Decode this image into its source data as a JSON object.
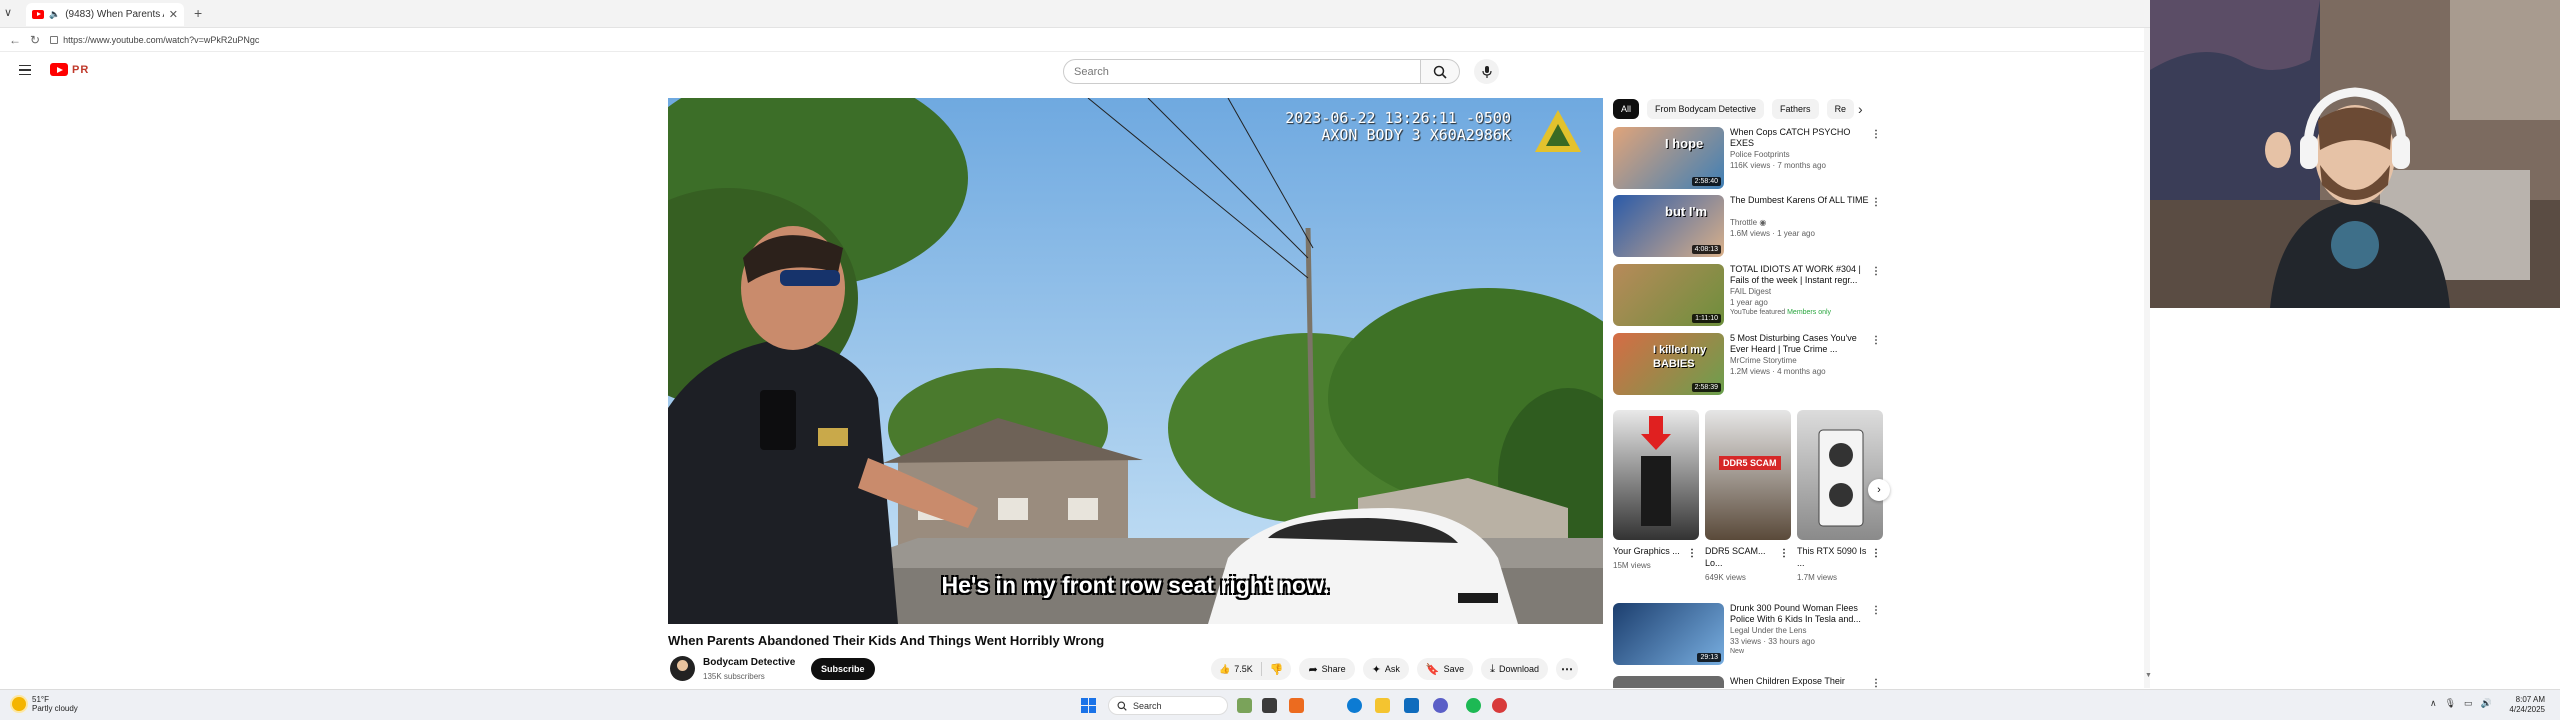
{
  "browser": {
    "tab_title": "(9483) When Parents Abando",
    "url": "https://www.youtube.com/watch?v=wPkR2uPNgc"
  },
  "youtube": {
    "logo_text": "PR",
    "search_placeholder": "Search"
  },
  "video": {
    "timestamp": "2023-06-22 13:26:11 -0500",
    "device_id": "AXON BODY 3 X60A2986K",
    "subtitle": "He's in my front row seat right now.",
    "title": "When Parents Abandoned Their Kids And Things Went Horribly Wrong",
    "channel_name": "Bodycam Detective",
    "subscribers": "135K subscribers",
    "subscribe_label": "Subscribe",
    "likes": "7.5K",
    "actions": [
      "Share",
      "Ask",
      "Save",
      "Download"
    ]
  },
  "sidebar": {
    "chips": [
      "All",
      "From Bodycam Detective",
      "Fathers",
      "Re"
    ],
    "recommendations": [
      {
        "title": "When Cops CATCH PSYCHO EXES",
        "channel": "Police Footprints",
        "meta": "116K views · 7 months ago",
        "duration": "2:58:40",
        "thumb_text": "I hope"
      },
      {
        "title": "The Dumbest Karens Of ALL TIME",
        "channel": "Throttle ◉",
        "meta": "1.6M views · 1 year ago",
        "duration": "4:08:13",
        "thumb_text": "but I'm"
      },
      {
        "title": "TOTAL IDIOTS AT WORK #304 | Fails of the week | Instant regr...",
        "channel": "FAIL Digest",
        "meta": "1 year ago",
        "extra": "YouTube featured",
        "member": "Members only",
        "duration": "1:11:10",
        "thumb_text": ""
      },
      {
        "title": "5 Most Disturbing Cases You've Ever Heard | True Crime ...",
        "channel": "MrCrime Storytime",
        "meta": "1.2M views · 4 months ago",
        "duration": "2:58:39",
        "thumb_text": "I killed my BABIES"
      }
    ],
    "shorts": [
      {
        "title": "Your Graphics ...",
        "views": "15M views"
      },
      {
        "title": "DDR5 SCAM... Lo...",
        "views": "649K views",
        "thumb_text": "DDR5 SCAM"
      },
      {
        "title": "This RTX 5090 Is ...",
        "views": "1.7M views"
      }
    ],
    "recommendations_2": [
      {
        "title": "Drunk 300 Pound Woman Flees Police With 6 Kids In Tesla and...",
        "channel": "Legal Under the Lens",
        "meta": "33 views · 33 hours ago",
        "extra": "New",
        "duration": "29:13"
      },
      {
        "title": "When Children Expose Their",
        "channel": "",
        "meta": "",
        "duration": ""
      }
    ]
  },
  "taskbar": {
    "temperature": "51°F",
    "weather": "Partly cloudy",
    "search_label": "Search",
    "time": "8:07 AM",
    "date": "4/24/2025"
  }
}
